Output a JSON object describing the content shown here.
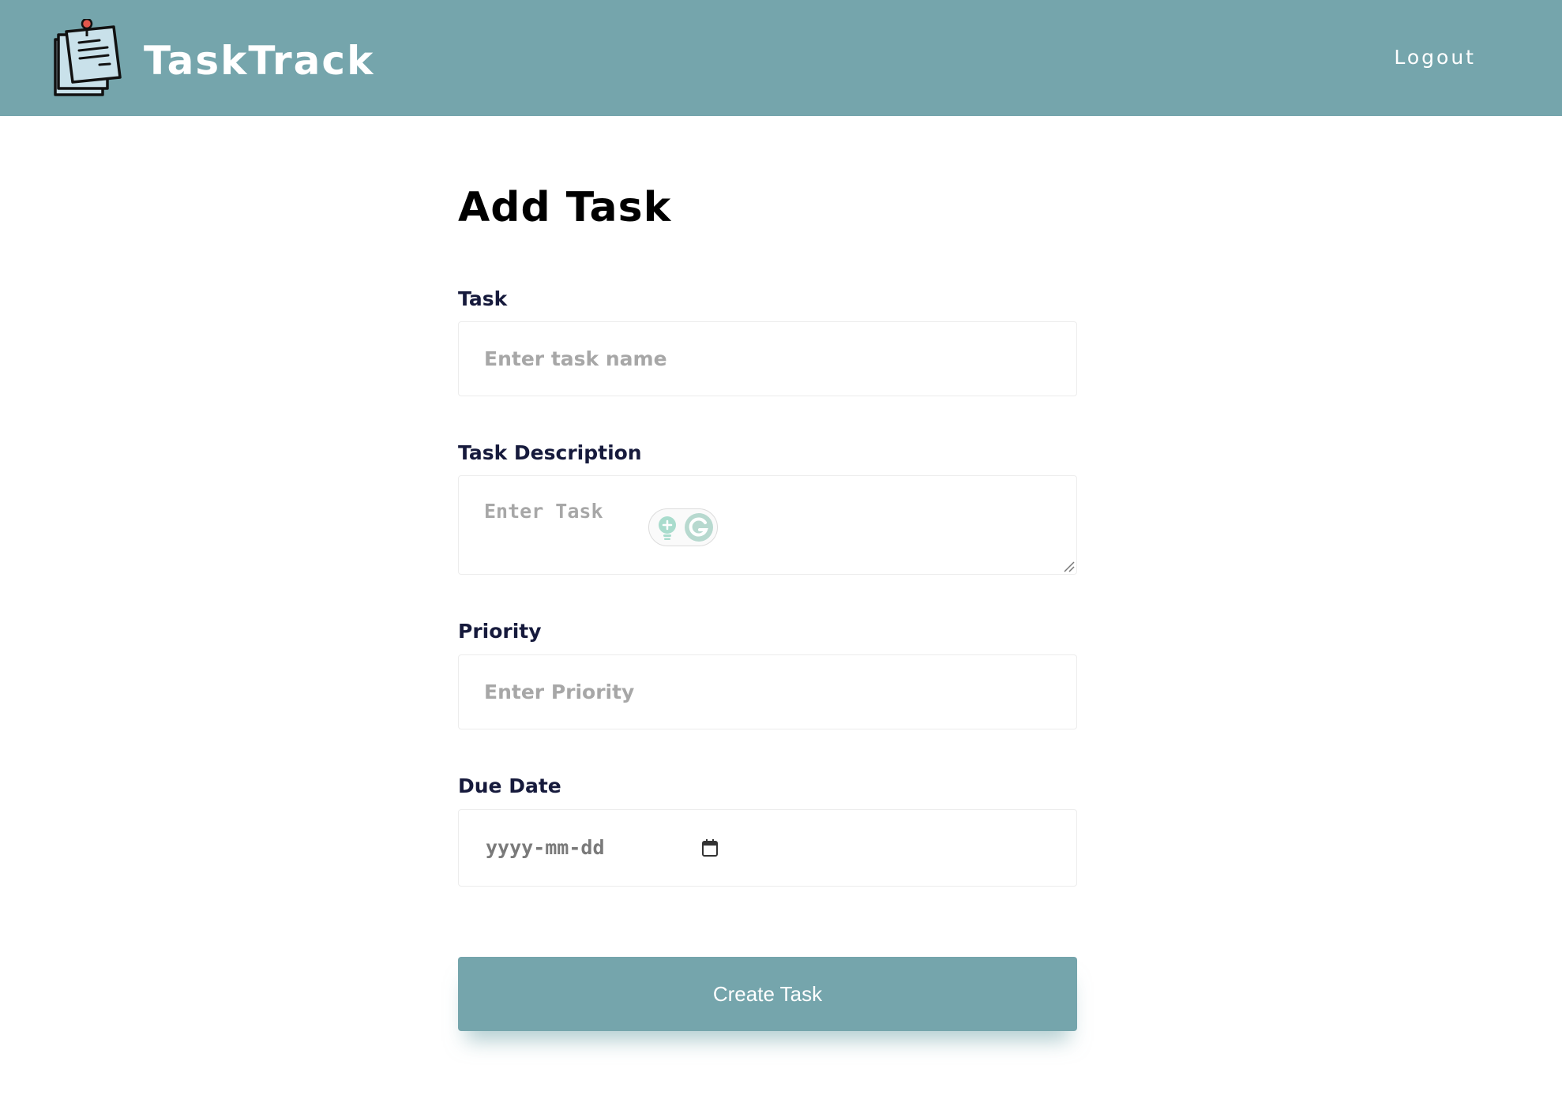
{
  "app": {
    "name": "TaskTrack",
    "logout_label": "Logout"
  },
  "page": {
    "title": "Add Task"
  },
  "form": {
    "task": {
      "label": "Task",
      "value": "",
      "placeholder": "Enter task name"
    },
    "description": {
      "label": "Task Description",
      "value": "",
      "placeholder": "Enter Task"
    },
    "priority": {
      "label": "Priority",
      "value": "",
      "placeholder": "Enter Priority"
    },
    "due_date": {
      "label": "Due Date",
      "display": "yyyy-mm-dd"
    },
    "submit_label": "Create Task"
  },
  "icons": {
    "logo": "sticky-notes-pin-icon",
    "calendar": "calendar-icon",
    "grammarly": "grammarly-icon",
    "suggestion": "lightbulb-icon"
  },
  "colors": {
    "brand": "#75a5ac",
    "label_text": "#161a3c",
    "placeholder": "#a7a7a7",
    "grammarly_accent": "#9fd3c4"
  }
}
